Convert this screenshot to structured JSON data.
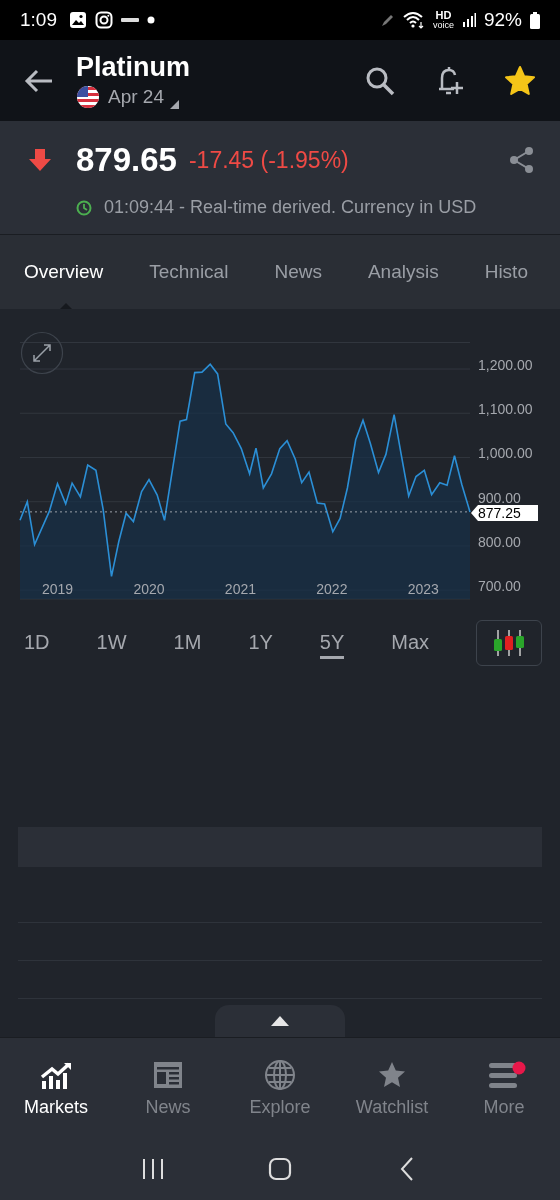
{
  "status_bar": {
    "time": "1:09",
    "hd_label": "HD",
    "hd_sublabel": "voice",
    "battery": "92%"
  },
  "header": {
    "title": "Platinum",
    "contract": "Apr 24",
    "starred": true
  },
  "quote": {
    "falling": true,
    "price": "879.65",
    "change": "-17.45 (-1.95%)",
    "note": "01:09:44 - Real-time derived. Currency in USD"
  },
  "tabs": [
    {
      "label": "Overview",
      "selected": true
    },
    {
      "label": "Technical",
      "selected": false
    },
    {
      "label": "News",
      "selected": false
    },
    {
      "label": "Analysis",
      "selected": false
    },
    {
      "label": "Histo",
      "selected": false
    }
  ],
  "chart": {
    "current_price": "877.25",
    "chart_data": {
      "type": "area",
      "grid": true,
      "xlim": [
        2018.59,
        2023.51
      ],
      "ylim": [
        680,
        1260
      ],
      "xticks": [
        2019,
        2020,
        2021,
        2022,
        2023
      ],
      "yticks": [
        {
          "value": 1200,
          "label": "1,200.00"
        },
        {
          "value": 1100,
          "label": "1,100.00"
        },
        {
          "value": 1000,
          "label": "1,000.00"
        },
        {
          "value": 900,
          "label": "900.00"
        },
        {
          "value": 800,
          "label": "800.00"
        },
        {
          "value": 700,
          "label": "700.00"
        }
      ],
      "x": [
        2018.59,
        2018.67,
        2018.75,
        2018.91,
        2019.0,
        2019.09,
        2019.16,
        2019.25,
        2019.33,
        2019.42,
        2019.5,
        2019.59,
        2019.67,
        2019.75,
        2019.83,
        2019.92,
        2020.0,
        2020.09,
        2020.17,
        2020.34,
        2020.41,
        2020.5,
        2020.58,
        2020.67,
        2020.75,
        2020.84,
        2020.92,
        2021.01,
        2021.1,
        2021.17,
        2021.25,
        2021.34,
        2021.43,
        2021.51,
        2021.6,
        2021.67,
        2021.75,
        2021.84,
        2021.92,
        2022.01,
        2022.09,
        2022.17,
        2022.26,
        2022.34,
        2022.42,
        2022.51,
        2022.59,
        2022.68,
        2022.76,
        2022.84,
        2022.92,
        2023.01,
        2023.09,
        2023.18,
        2023.26,
        2023.34,
        2023.42,
        2023.51
      ],
      "series": [
        {
          "color": "#2b8fd6",
          "values": [
            858,
            900,
            803,
            878,
            941,
            895,
            942,
            911,
            983,
            971,
            882,
            731,
            810,
            874,
            855,
            923,
            950,
            915,
            858,
            1082,
            1086,
            1192,
            1193,
            1211,
            1189,
            1076,
            1056,
            1020,
            963,
            1021,
            931,
            963,
            1020,
            1038,
            996,
            943,
            967,
            897,
            895,
            832,
            862,
            931,
            1040,
            1084,
            1032,
            966,
            1007,
            1097,
            1004,
            913,
            957,
            971,
            916,
            943,
            937,
            1004,
            939,
            877
          ]
        }
      ]
    }
  },
  "ranges": [
    {
      "label": "1D",
      "selected": false
    },
    {
      "label": "1W",
      "selected": false
    },
    {
      "label": "1M",
      "selected": false
    },
    {
      "label": "1Y",
      "selected": false
    },
    {
      "label": "5Y",
      "selected": true
    },
    {
      "label": "Max",
      "selected": false
    }
  ],
  "bottom_nav": [
    {
      "label": "Markets",
      "selected": true,
      "badge": false
    },
    {
      "label": "News",
      "selected": false,
      "badge": false
    },
    {
      "label": "Explore",
      "selected": false,
      "badge": false
    },
    {
      "label": "Watchlist",
      "selected": false,
      "badge": false
    },
    {
      "label": "More",
      "selected": false,
      "badge": true
    }
  ]
}
